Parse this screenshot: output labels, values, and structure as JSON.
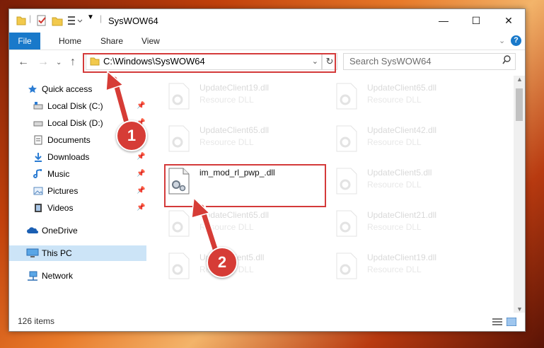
{
  "window": {
    "title": "SysWOW64",
    "controls": {
      "minimize": "—",
      "maximize": "☐",
      "close": "✕"
    }
  },
  "ribbon": {
    "tabs": [
      "File",
      "Home",
      "Share",
      "View"
    ],
    "help": "?"
  },
  "navigation": {
    "address": "C:\\Windows\\SysWOW64",
    "search_placeholder": "Search SysWOW64"
  },
  "sidebar": {
    "items": [
      {
        "label": "Quick access",
        "icon": "star-icon"
      },
      {
        "label": "Local Disk (C:)",
        "icon": "drive-icon",
        "pinned": true
      },
      {
        "label": "Local Disk (D:)",
        "icon": "drive-icon",
        "pinned": true
      },
      {
        "label": "Documents",
        "icon": "documents-icon",
        "pinned": true
      },
      {
        "label": "Downloads",
        "icon": "download-icon",
        "pinned": true
      },
      {
        "label": "Music",
        "icon": "music-icon",
        "pinned": true
      },
      {
        "label": "Pictures",
        "icon": "pictures-icon",
        "pinned": true
      },
      {
        "label": "Videos",
        "icon": "videos-icon",
        "pinned": true
      },
      {
        "label": "OneDrive",
        "icon": "cloud-icon"
      },
      {
        "label": "This PC",
        "icon": "computer-icon",
        "selected": true
      },
      {
        "label": "Network",
        "icon": "network-icon"
      }
    ]
  },
  "files": [
    {
      "name": "UpdateClient19.dll",
      "type": "Resource DLL"
    },
    {
      "name": "UpdateClient65.dll",
      "type": "Resource DLL"
    },
    {
      "name": "UpdateClient65.dll",
      "type": "Resource DLL"
    },
    {
      "name": "UpdateClient42.dll",
      "type": "Resource DLL"
    },
    {
      "name": "im_mod_rl_pwp_.dll",
      "type": ""
    },
    {
      "name": "UpdateClient5.dll",
      "type": "Resource DLL"
    },
    {
      "name": "UpdateClient65.dll",
      "type": "Resource DLL"
    },
    {
      "name": "UpdateClient21.dll",
      "type": "Resource DLL"
    },
    {
      "name": "UpdateClient5.dll",
      "type": "Resource DLL"
    },
    {
      "name": "UpdateClient19.dll",
      "type": "Resource DLL"
    }
  ],
  "status": {
    "item_count": "126 items"
  },
  "annotations": {
    "step1": "1",
    "step2": "2"
  },
  "colors": {
    "accent": "#1979ca",
    "highlight": "#d43a3a",
    "selection": "#cce4f7"
  }
}
